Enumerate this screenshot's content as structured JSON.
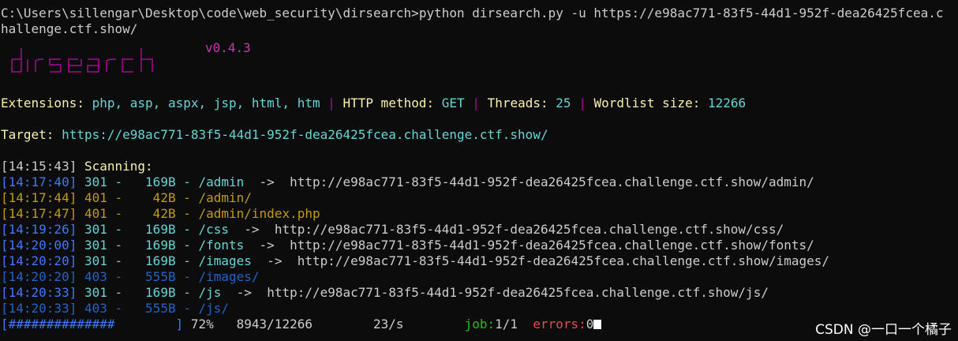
{
  "terminal": {
    "command_prompt": "C:\\Users\\sillengar\\Desktop\\code\\web_security\\dirsearch>",
    "command": "python dirsearch.py -u https://e98ac771-83f5-44d1-952f-dea26425fcea.challenge.ctf.show/",
    "logo_text": "dirsearch",
    "version": "v0.4.3",
    "config": {
      "extensions_label": "Extensions:",
      "extensions_value": "php, asp, aspx, jsp, html, htm",
      "method_label": "HTTP method:",
      "method_value": "GET",
      "threads_label": "Threads:",
      "threads_value": "25",
      "wordlist_label": "Wordlist size:",
      "wordlist_value": "12266",
      "separator": "|"
    },
    "target_label": "Target:",
    "target_url": "https://e98ac771-83f5-44d1-952f-dea26425fcea.challenge.ctf.show/",
    "scanning": {
      "time": "[14:15:43]",
      "text": "Scanning:"
    },
    "results": [
      {
        "time": "[14:17:40]",
        "status": "301 -",
        "size": "169B -",
        "path": "/admin",
        "redirect": "->  http://e98ac771-83f5-44d1-952f-dea26425fcea.challenge.ctf.show/admin/",
        "color": "blue"
      },
      {
        "time": "[14:17:44]",
        "status": "401 -",
        "size": " 42B -",
        "path": "/admin/",
        "redirect": "",
        "color": "amber"
      },
      {
        "time": "[14:17:47]",
        "status": "401 -",
        "size": " 42B -",
        "path": "/admin/index.php",
        "redirect": "",
        "color": "amber"
      },
      {
        "time": "[14:19:26]",
        "status": "301 -",
        "size": "169B -",
        "path": "/css",
        "redirect": "->  http://e98ac771-83f5-44d1-952f-dea26425fcea.challenge.ctf.show/css/",
        "color": "blue"
      },
      {
        "time": "[14:20:00]",
        "status": "301 -",
        "size": "169B -",
        "path": "/fonts",
        "redirect": "->  http://e98ac771-83f5-44d1-952f-dea26425fcea.challenge.ctf.show/fonts/",
        "color": "blue"
      },
      {
        "time": "[14:20:20]",
        "status": "301 -",
        "size": "169B -",
        "path": "/images",
        "redirect": "->  http://e98ac771-83f5-44d1-952f-dea26425fcea.challenge.ctf.show/images/",
        "color": "blue"
      },
      {
        "time": "[14:20:20]",
        "status": "403 -",
        "size": "555B -",
        "path": "/images/",
        "redirect": "",
        "color": "blue-dark"
      },
      {
        "time": "[14:20:33]",
        "status": "301 -",
        "size": "169B -",
        "path": "/js",
        "redirect": "->  http://e98ac771-83f5-44d1-952f-dea26425fcea.challenge.ctf.show/js/",
        "color": "blue"
      },
      {
        "time": "[14:20:33]",
        "status": "403 -",
        "size": "555B -",
        "path": "/js/",
        "redirect": "",
        "color": "blue-dark"
      }
    ],
    "progress": {
      "bar": "[##############        ]",
      "percent": "72%",
      "count": "8943/12266",
      "rate": "23/s",
      "job_label": "job:",
      "job_value": "1/1",
      "errors_label": "errors:",
      "errors_value": "0",
      "fraction": 0.72
    }
  },
  "watermark": "CSDN @一口一个橘子",
  "colors": {
    "background": "#0c0c0c",
    "text": "#cccccc",
    "yellow": "#f9f1a5",
    "cyan": "#61d6d6",
    "blue": "#3b78ff",
    "amber": "#c19c00",
    "green": "#16c60c",
    "red": "#e74856",
    "magenta": "#c239b3"
  }
}
